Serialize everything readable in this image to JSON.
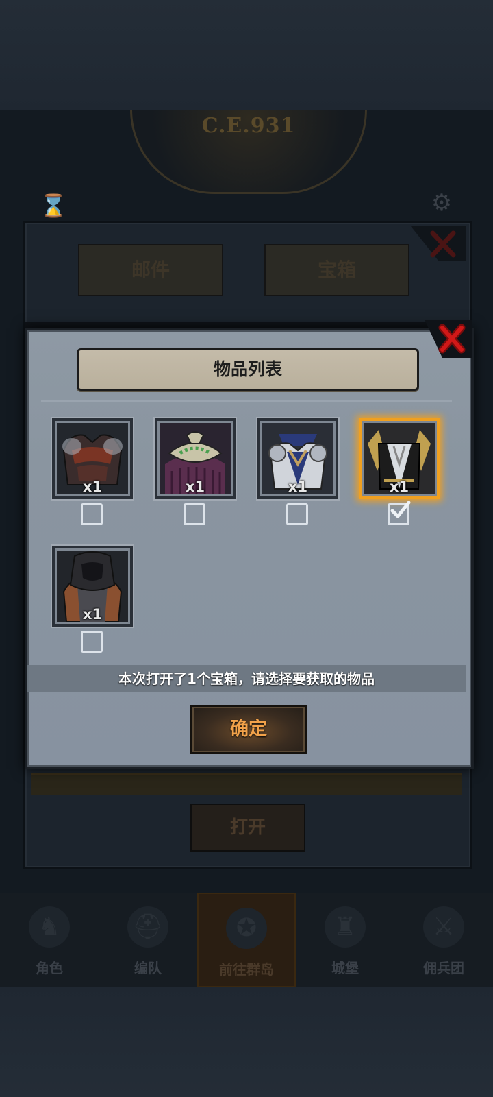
{
  "background": {
    "year_badge": "C.E.931",
    "tabs": [
      {
        "label": "邮件"
      },
      {
        "label": "宝箱"
      }
    ],
    "open_button": "打开",
    "bottom_nav": [
      {
        "label": "角色",
        "icon": "knight-icon"
      },
      {
        "label": "编队",
        "icon": "helmet-icon"
      },
      {
        "label": "前往群岛",
        "icon": "compass-icon",
        "active": true
      },
      {
        "label": "城堡",
        "icon": "castle-icon"
      },
      {
        "label": "佣兵团",
        "icon": "soldier-icon"
      }
    ]
  },
  "dialog": {
    "title": "物品列表",
    "items": [
      {
        "name": "dark-plate-armor",
        "quantity": "x1",
        "selected": false,
        "colors": [
          "#3a2c2c",
          "#7a3424",
          "#b0b6c0"
        ]
      },
      {
        "name": "purple-robe",
        "quantity": "x1",
        "selected": false,
        "colors": [
          "#5a2e4e",
          "#c8c4a8",
          "#4aa050"
        ]
      },
      {
        "name": "silver-blue-armor",
        "quantity": "x1",
        "selected": false,
        "colors": [
          "#d0d4da",
          "#2a3a7a",
          "#c0a060"
        ]
      },
      {
        "name": "golden-dark-armor",
        "quantity": "x1",
        "selected": true,
        "colors": [
          "#1c1c1c",
          "#c0a050",
          "#d8dce0"
        ]
      },
      {
        "name": "hooded-leather-armor",
        "quantity": "x1",
        "selected": false,
        "colors": [
          "#2a2a2e",
          "#8a5030",
          "#4a4a50"
        ]
      }
    ],
    "info_text": "本次打开了1个宝箱，请选择要获取的物品",
    "confirm_button": "确定"
  },
  "colors": {
    "selection_glow": "#f0a020",
    "confirm_text": "#f2a24a",
    "close_x": "#d01818"
  }
}
